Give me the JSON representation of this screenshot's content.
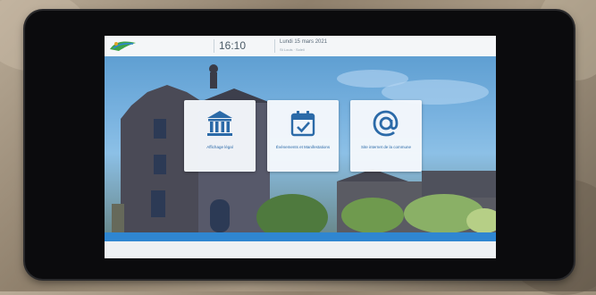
{
  "header": {
    "time": "16:10",
    "date": "Lundi 15 mars 2021",
    "subdate": "St Louis · Soleil"
  },
  "tiles": [
    {
      "label": "Affichage légal",
      "icon": "institution-icon"
    },
    {
      "label": "Événements et Manifestations",
      "icon": "calendar-check-icon"
    },
    {
      "label": "Site internet de la commune",
      "icon": "at-sign-icon"
    }
  ],
  "footer": {
    "text": ""
  },
  "colors": {
    "accent": "#2f86d1",
    "tile_icon": "#2b6aa8",
    "bezel": "#0b0b0d"
  }
}
